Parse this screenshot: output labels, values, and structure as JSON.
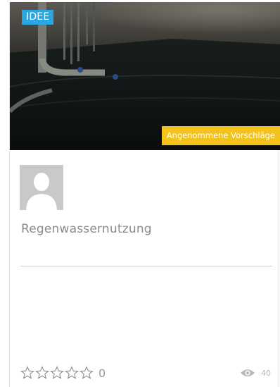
{
  "card": {
    "category_badge": "IDEE",
    "status_badge": "Angenommene Vorschläge",
    "title": "Regenwassernutzung",
    "rating_count": "0",
    "view_count": "40",
    "rating_stars_filled": 0,
    "rating_stars_total": 5
  },
  "icons": {
    "avatar": "user-silhouette-icon",
    "star": "star-outline-icon",
    "views": "eye-icon"
  },
  "colors": {
    "category_badge": "#2aa7e3",
    "status_badge": "#f3c21c",
    "title_text": "#8b8b8b",
    "star_outline": "#8f8f8f"
  }
}
